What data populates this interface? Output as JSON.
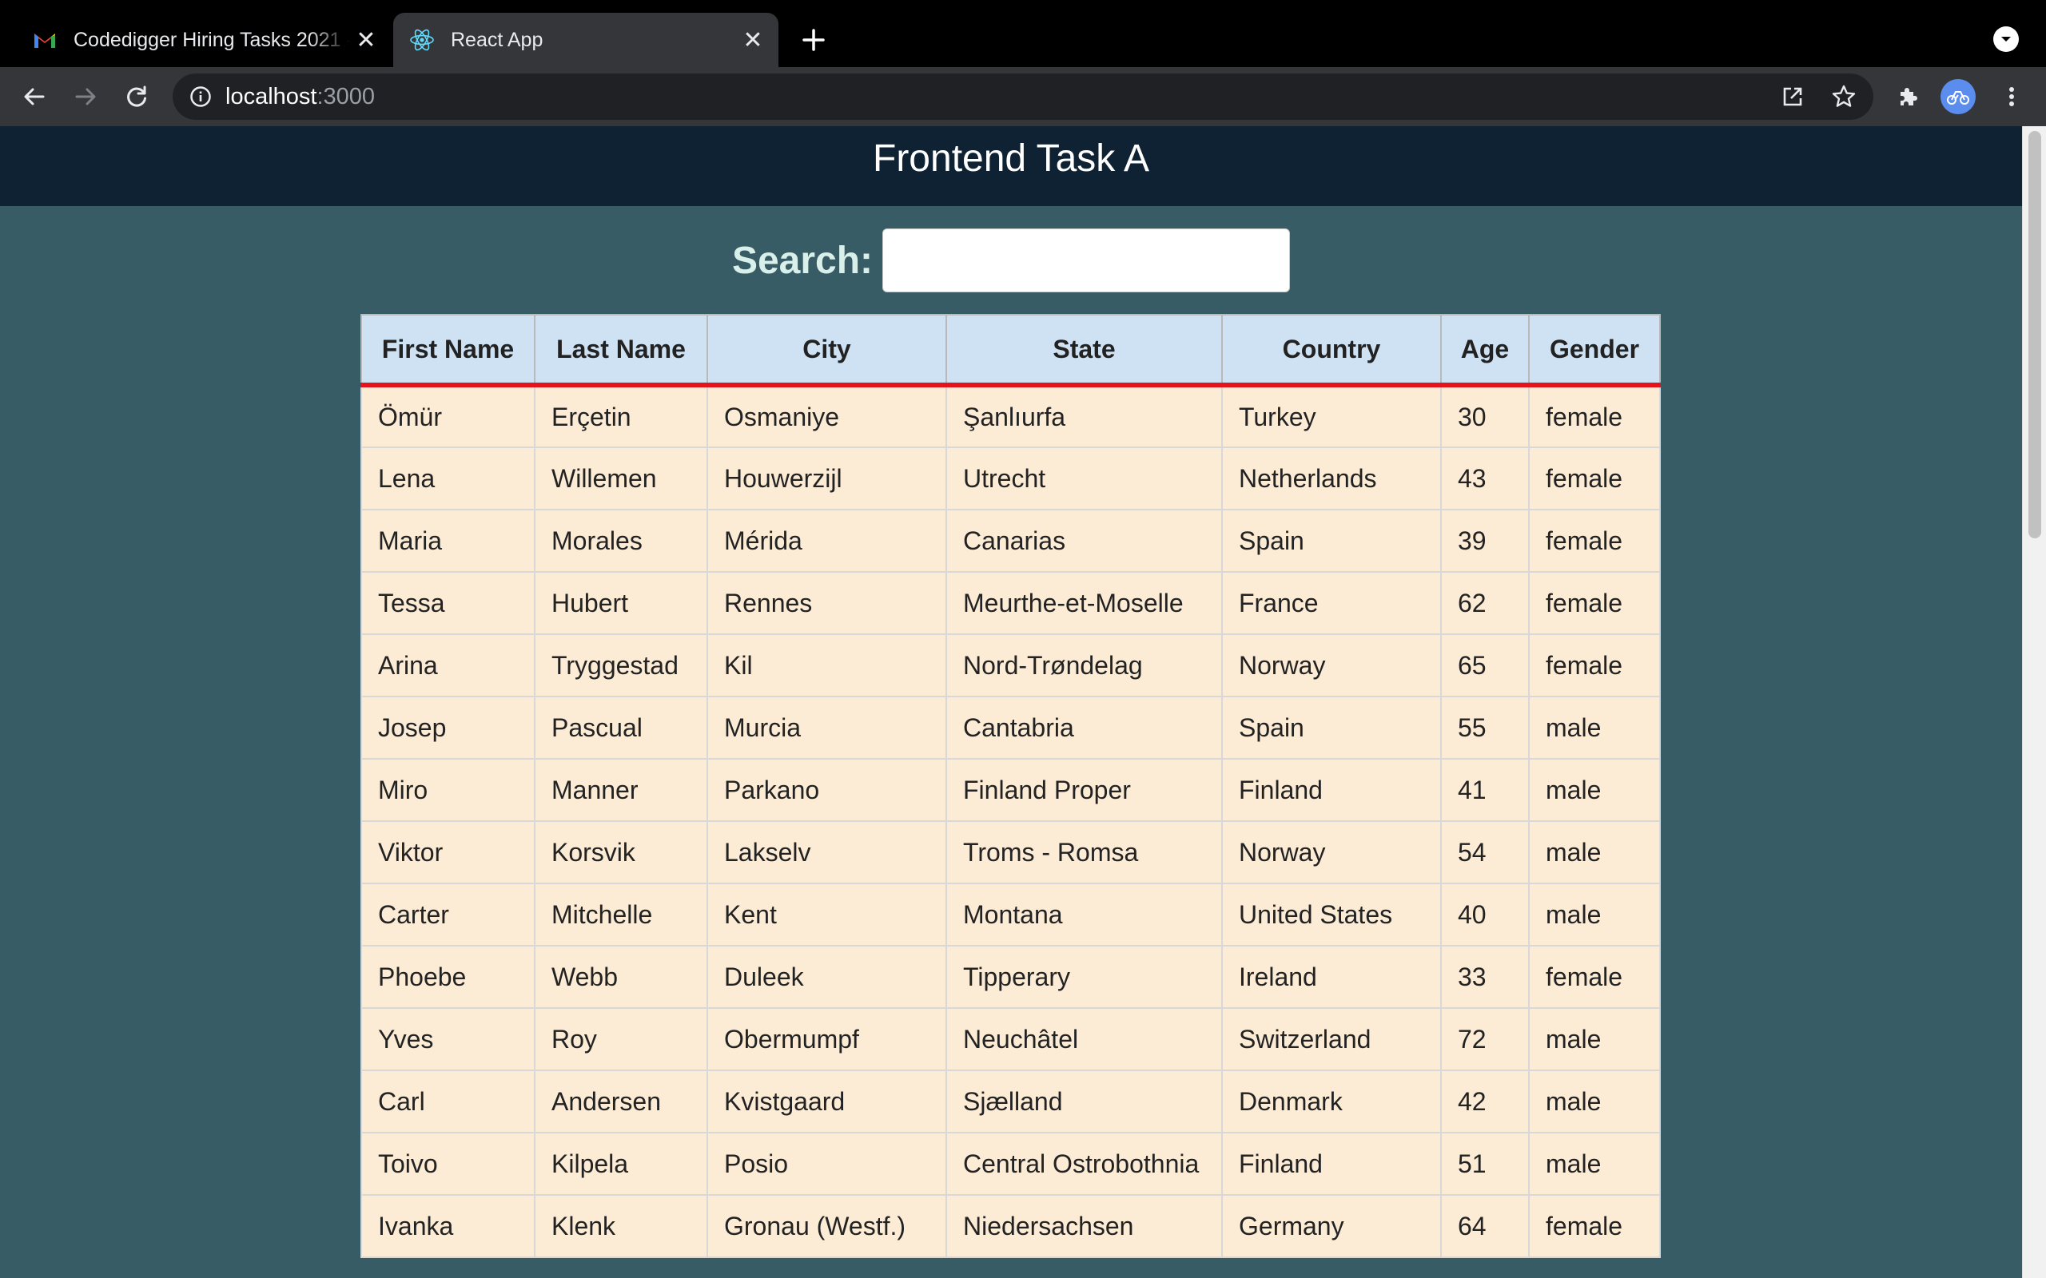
{
  "browser": {
    "tabs": [
      {
        "title": "Codedigger Hiring Tasks 2021 -",
        "icon": "gmail-icon",
        "active": false
      },
      {
        "title": "React App",
        "icon": "react-icon",
        "active": true
      }
    ],
    "url_host": "localhost",
    "url_port": ":3000"
  },
  "page": {
    "title": "Frontend Task A",
    "search_label": "Search:",
    "search_value": ""
  },
  "table": {
    "columns": [
      "First Name",
      "Last Name",
      "City",
      "State",
      "Country",
      "Age",
      "Gender"
    ],
    "rows": [
      [
        "Ömür",
        "Erçetin",
        "Osmaniye",
        "Şanlıurfa",
        "Turkey",
        "30",
        "female"
      ],
      [
        "Lena",
        "Willemen",
        "Houwerzijl",
        "Utrecht",
        "Netherlands",
        "43",
        "female"
      ],
      [
        "Maria",
        "Morales",
        "Mérida",
        "Canarias",
        "Spain",
        "39",
        "female"
      ],
      [
        "Tessa",
        "Hubert",
        "Rennes",
        "Meurthe-et-Moselle",
        "France",
        "62",
        "female"
      ],
      [
        "Arina",
        "Tryggestad",
        "Kil",
        "Nord-Trøndelag",
        "Norway",
        "65",
        "female"
      ],
      [
        "Josep",
        "Pascual",
        "Murcia",
        "Cantabria",
        "Spain",
        "55",
        "male"
      ],
      [
        "Miro",
        "Manner",
        "Parkano",
        "Finland Proper",
        "Finland",
        "41",
        "male"
      ],
      [
        "Viktor",
        "Korsvik",
        "Lakselv",
        "Troms - Romsa",
        "Norway",
        "54",
        "male"
      ],
      [
        "Carter",
        "Mitchelle",
        "Kent",
        "Montana",
        "United States",
        "40",
        "male"
      ],
      [
        "Phoebe",
        "Webb",
        "Duleek",
        "Tipperary",
        "Ireland",
        "33",
        "female"
      ],
      [
        "Yves",
        "Roy",
        "Obermumpf",
        "Neuchâtel",
        "Switzerland",
        "72",
        "male"
      ],
      [
        "Carl",
        "Andersen",
        "Kvistgaard",
        "Sjælland",
        "Denmark",
        "42",
        "male"
      ],
      [
        "Toivo",
        "Kilpela",
        "Posio",
        "Central Ostrobothnia",
        "Finland",
        "51",
        "male"
      ],
      [
        "Ivanka",
        "Klenk",
        "Gronau (Westf.)",
        "Niedersachsen",
        "Germany",
        "64",
        "female"
      ]
    ]
  },
  "colors": {
    "header_bg": "#0f2233",
    "page_bg": "#375c66",
    "th_bg": "#cfe2f3",
    "td_bg": "#fdecd5",
    "accent_border": "#e4141c"
  }
}
